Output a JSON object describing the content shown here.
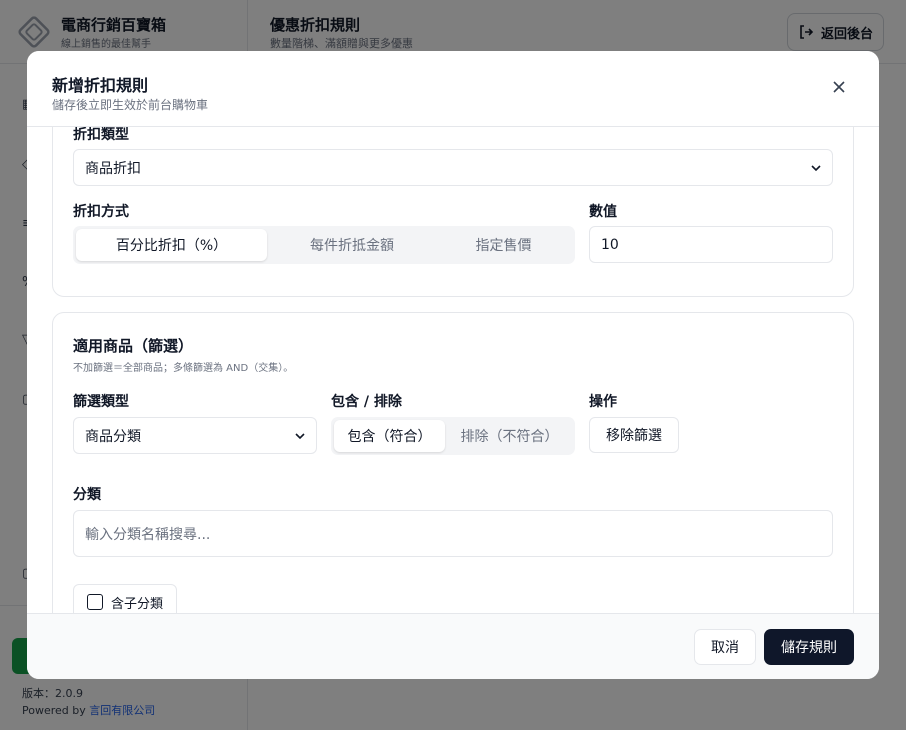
{
  "app": {
    "brand_name": "電商行銷百寶箱",
    "brand_subtitle": "線上銷售的最佳幫手",
    "page_title": "優惠折扣規則",
    "page_subtitle": "數量階梯、滿額贈與更多優惠",
    "back_label": "返回後台",
    "version_text": "版本：2.0.9",
    "powered_prefix": "Powered by ",
    "powered_company": "言回有限公司"
  },
  "modal": {
    "title": "新增折扣規則",
    "subtitle": "儲存後立即生效於前台購物車",
    "discount_type_label": "折扣類型",
    "discount_type_value": "商品折扣",
    "discount_method_label": "折扣方式",
    "discount_methods": [
      "百分比折扣（%）",
      "每件折抵金額",
      "指定售價"
    ],
    "active_method_index": 0,
    "value_label": "數值",
    "value": "10",
    "scope_title": "適用商品（篩選）",
    "scope_hint": "不加篩選＝全部商品；多條篩選為 AND（交集）。",
    "filter_type_label": "篩選類型",
    "filter_type_value": "商品分類",
    "include_exclude_label": "包含 / 排除",
    "include_label": "包含（符合）",
    "exclude_label": "排除（不符合）",
    "action_label": "操作",
    "remove_filter_label": "移除篩選",
    "category_label": "分類",
    "category_placeholder": "輸入分類名稱搜尋...",
    "include_children_label": "含子分類",
    "cancel_label": "取消",
    "save_label": "儲存規則"
  },
  "colors": {
    "primary_button": "#0f172a",
    "accent_green": "#16a34a",
    "link_blue": "#2563eb"
  }
}
